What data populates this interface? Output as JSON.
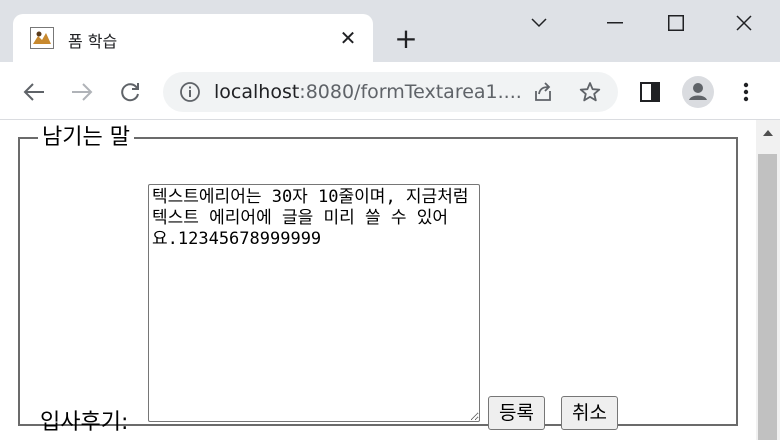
{
  "browser": {
    "tab_title": "폼 학습",
    "url_host": "localhost",
    "url_rest": ":8080/formTextarea1....",
    "new_tab_glyph": "+",
    "close_glyph": "✕"
  },
  "form": {
    "legend": "남기는 말",
    "label": "입사후기:",
    "textarea_value": "텍스트에리어는 30자 10줄이며, 지금처럼 텍스트 에리어에 글을 미리 쓸 수 있어요.12345678999999",
    "submit_label": "등록",
    "cancel_label": "취소"
  },
  "icons": [
    "tab-favicon-icon",
    "close-icon",
    "plus-icon",
    "chevron-down-icon",
    "minimize-icon",
    "maximize-icon",
    "window-close-icon",
    "back-arrow-icon",
    "forward-arrow-icon",
    "reload-icon",
    "info-icon",
    "share-icon",
    "star-icon",
    "side-panel-icon",
    "profile-icon",
    "kebab-menu-icon",
    "scroll-up-arrow-icon"
  ]
}
